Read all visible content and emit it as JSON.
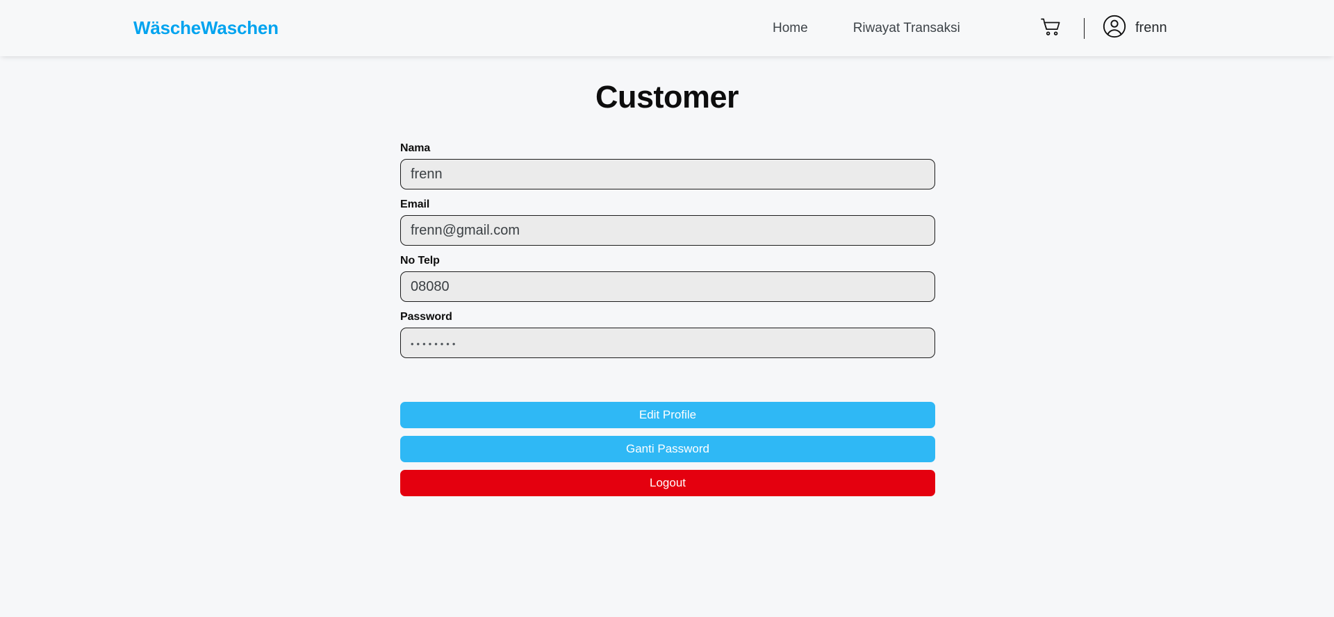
{
  "header": {
    "brand": "WäscheWaschen",
    "nav_links": [
      {
        "label": "Home",
        "name": "nav-link-home"
      },
      {
        "label": "Riwayat Transaksi",
        "name": "nav-link-riwayat-transaksi"
      }
    ],
    "cart_icon": "shopping-cart-icon",
    "avatar_icon": "user-circle-icon",
    "user_name": "frenn"
  },
  "main": {
    "title": "Customer",
    "fields": [
      {
        "label": "Nama",
        "value": "frenn",
        "type": "text"
      },
      {
        "label": "Email",
        "value": "frenn@gmail.com",
        "type": "text"
      },
      {
        "label": "No Telp",
        "value": "08080",
        "type": "text"
      },
      {
        "label": "Password",
        "value": "••••••••",
        "type": "password"
      }
    ],
    "buttons": [
      {
        "label": "Edit Profile",
        "style": "primary"
      },
      {
        "label": "Ganti Password",
        "style": "primary"
      },
      {
        "label": "Logout",
        "style": "danger"
      }
    ]
  },
  "colors": {
    "brand": "#00a3ef",
    "primary": "#2fb8f5",
    "danger": "#e4000f",
    "page_bg": "#f6f7f9",
    "header_bg": "#f7f8f9",
    "input_bg": "#ebebeb",
    "input_border": "#1b1b1b"
  }
}
